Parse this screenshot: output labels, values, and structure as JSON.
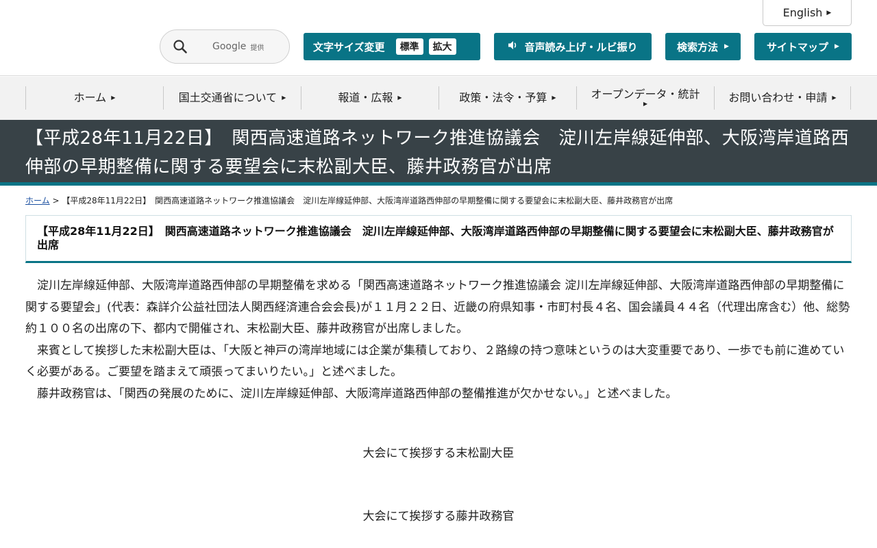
{
  "header": {
    "english_label": "English",
    "search": {
      "brand": "Google",
      "provided": "提供",
      "placeholder": ""
    },
    "font_size": {
      "label": "文字サイズ変更",
      "standard": "標準",
      "large": "拡大"
    },
    "voice_label": "音声読み上げ・ルビ振り",
    "search_method_label": "検索方法",
    "sitemap_label": "サイトマップ"
  },
  "nav": {
    "items": [
      {
        "label": "ホーム"
      },
      {
        "label": "国土交通省について"
      },
      {
        "label": "報道・広報"
      },
      {
        "label": "政策・法令・予算"
      },
      {
        "label": "オープンデータ・統計"
      },
      {
        "label": "お問い合わせ・申請"
      }
    ]
  },
  "page": {
    "title": "【平成28年11月22日】　関西高速道路ネットワーク推進協議会　淀川左岸線延伸部、大阪湾岸道路西伸部の早期整備に関する要望会に末松副大臣、藤井政務官が出席",
    "breadcrumb_home": "ホーム",
    "breadcrumb_sep": ">",
    "breadcrumb_current": "【平成28年11月22日】　関西高速道路ネットワーク推進協議会　淀川左岸線延伸部、大阪湾岸道路西伸部の早期整備に関する要望会に末松副大臣、藤井政務官が出席",
    "heading": "【平成28年11月22日】　関西高速道路ネットワーク推進協議会　淀川左岸線延伸部、大阪湾岸道路西伸部の早期整備に関する要望会に末松副大臣、藤井政務官が出席",
    "paragraphs": [
      "淀川左岸線延伸部、大阪湾岸道路西伸部の早期整備を求める「関西高速道路ネットワーク推進協議会 淀川左岸線延伸部、大阪湾岸道路西伸部の早期整備に関する要望会」(代表：森詳介公益社団法人関西経済連合会会長)が１１月２２日、近畿の府県知事・市町村長４名、国会議員４４名（代理出席含む）他、総勢約１００名の出席の下、都内で開催され、末松副大臣、藤井政務官が出席しました。",
      "来賓として挨拶した末松副大臣は、「大阪と神戸の湾岸地域には企業が集積しており、２路線の持つ意味というのは大変重要であり、一歩でも前に進めていく必要がある。ご要望を踏まえて頑張ってまいりたい。」と述べました。",
      "藤井政務官は、「関西の発展のために、淀川左岸線延伸部、大阪湾岸道路西伸部の整備推進が欠かせない。」と述べました。"
    ],
    "caption_1": "大会にて挨拶する末松副大臣",
    "caption_2": "大会にて挨拶する藤井政務官"
  },
  "colors": {
    "accent": "#097486",
    "banner": "#384247",
    "nav_bg": "#f2f2f2"
  }
}
